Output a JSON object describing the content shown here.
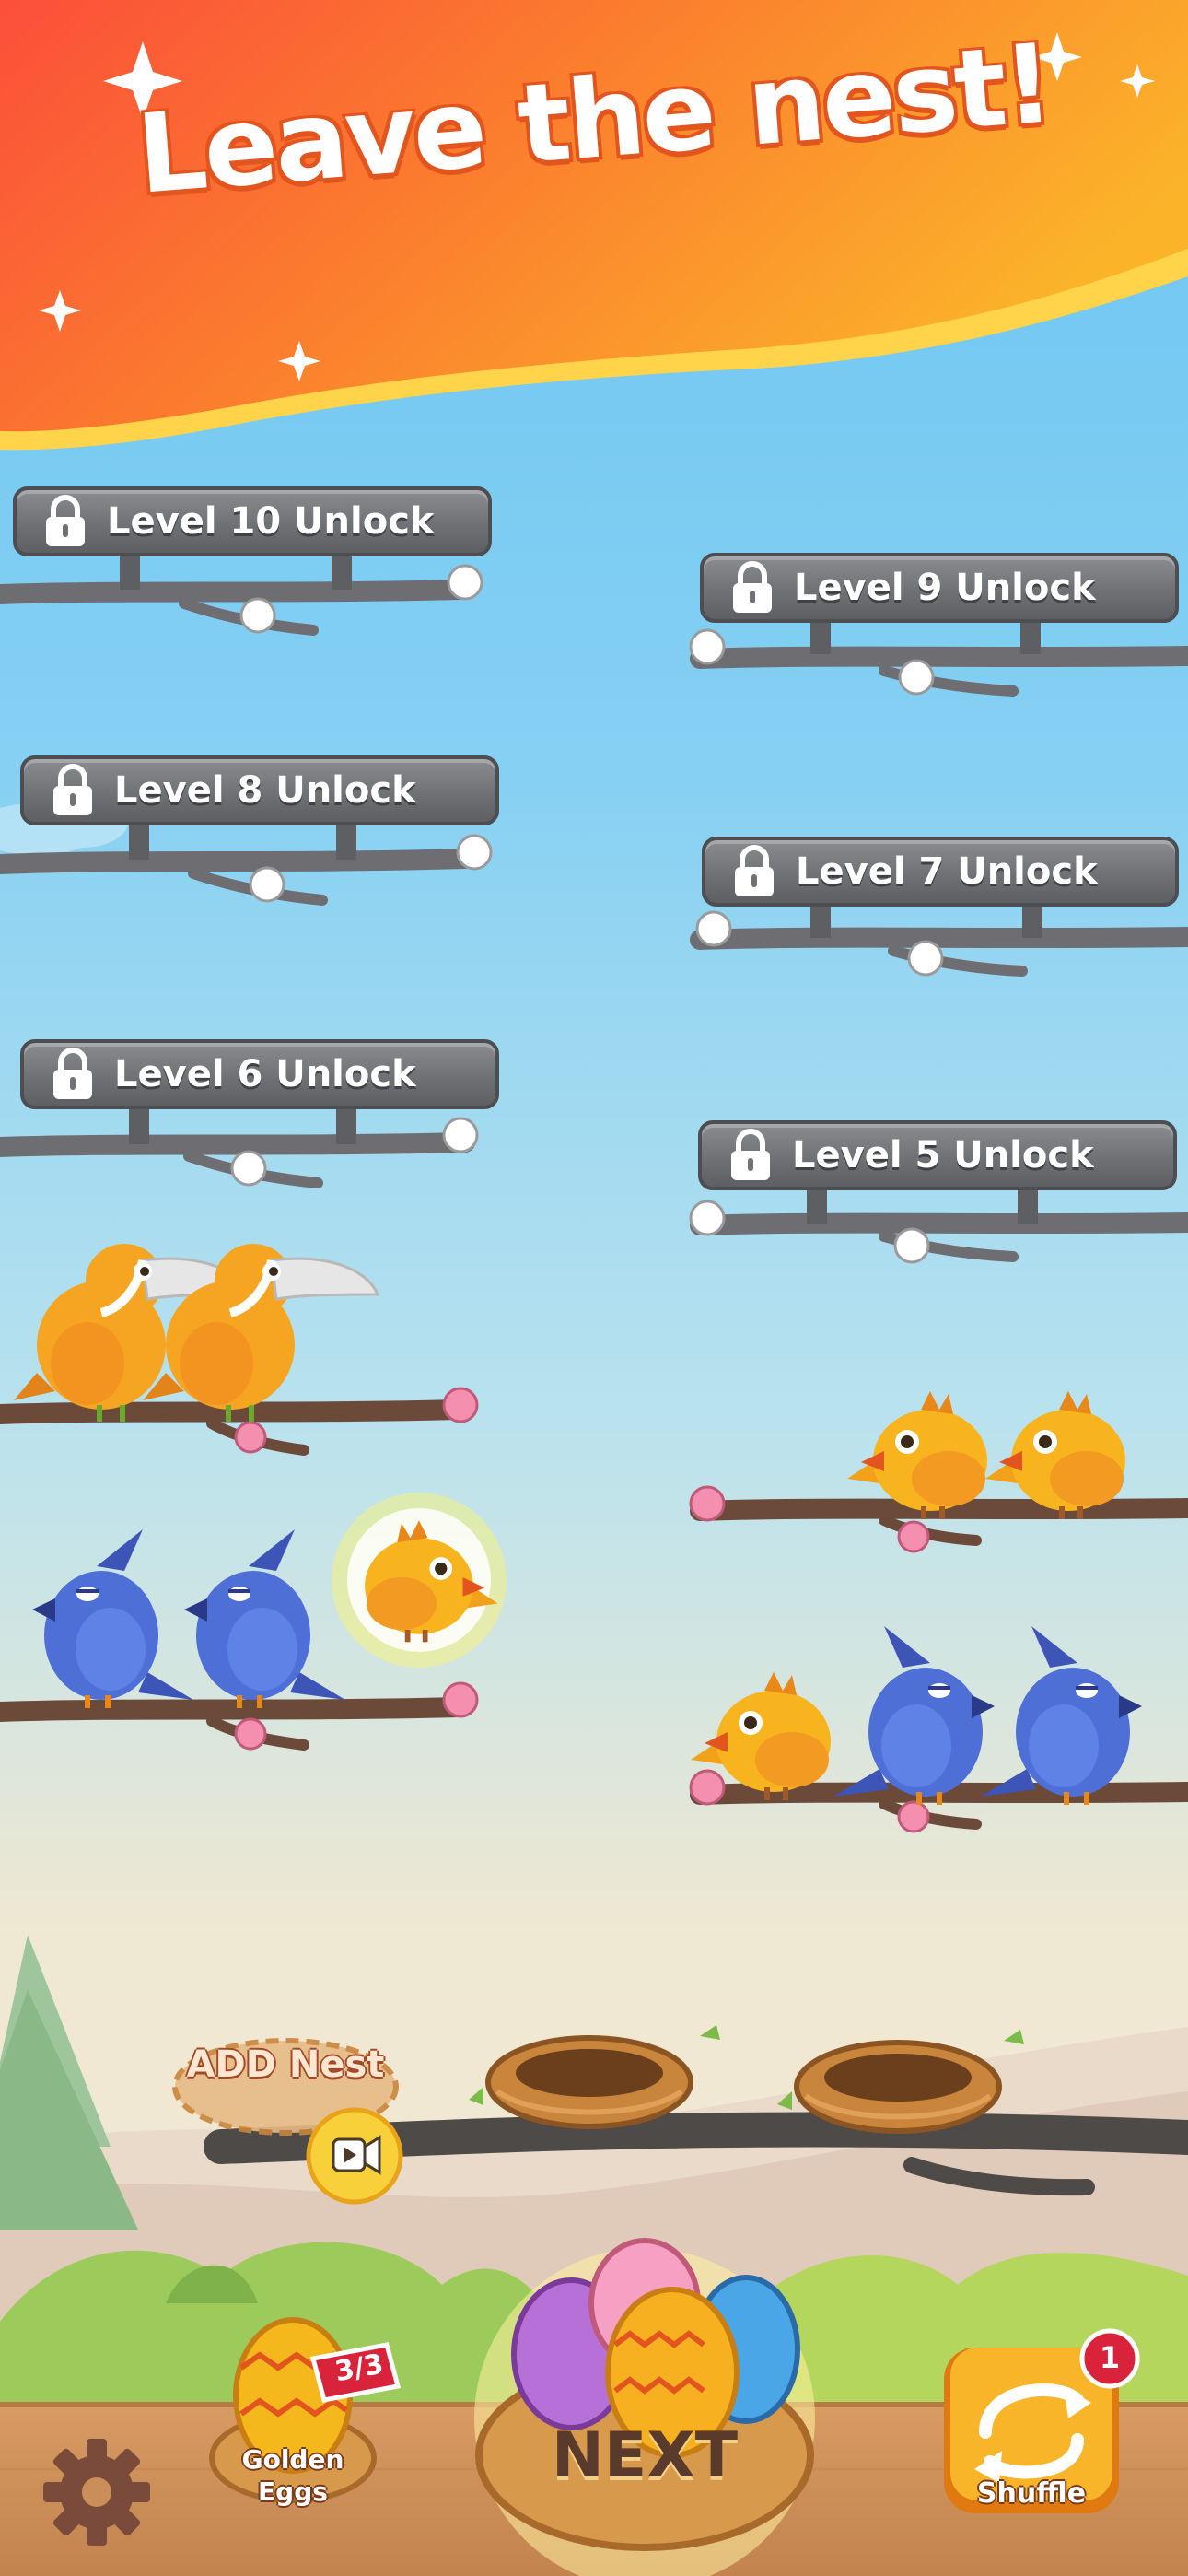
{
  "header": {
    "title": "Leave the nest!"
  },
  "levels": [
    {
      "label": "Level 10 Unlock",
      "locked": true
    },
    {
      "label": "Level 9 Unlock",
      "locked": true
    },
    {
      "label": "Level 8 Unlock",
      "locked": true
    },
    {
      "label": "Level 7 Unlock",
      "locked": true
    },
    {
      "label": "Level 6 Unlock",
      "locked": true
    },
    {
      "label": "Level 5 Unlock",
      "locked": true
    }
  ],
  "branches": [
    {
      "side": "left",
      "birds": [
        "toucan",
        "toucan"
      ]
    },
    {
      "side": "right",
      "birds": [
        "yellow-chick",
        "yellow-chick"
      ]
    },
    {
      "side": "left",
      "birds": [
        "blue-jay",
        "blue-jay"
      ]
    },
    {
      "side": "right",
      "birds": [
        "yellow-chick",
        "blue-jay",
        "blue-jay"
      ]
    }
  ],
  "flying_bird": {
    "type": "yellow-chick",
    "selected": true
  },
  "nests": {
    "add_nest_label": "ADD Nest",
    "add_nest_icon": "video-ad-icon",
    "empty_nests": 2
  },
  "bottom_bar": {
    "settings_icon": "gear-icon",
    "golden_eggs": {
      "label_line1": "Golden",
      "label_line2": "Eggs",
      "count_badge": "3/3"
    },
    "next_label": "NEXT",
    "shuffle": {
      "label": "Shuffle",
      "badge": "1",
      "icon": "shuffle-arrows-icon"
    }
  },
  "colors": {
    "title_outline": "#e2551f",
    "sign_gray": "#6f7175",
    "toucan": "#f6a522",
    "blue_jay": "#4e6fd6",
    "yellow_chick": "#f8b41e",
    "shuffle_orange": "#f39c1c",
    "badge_red": "#d9233a"
  }
}
